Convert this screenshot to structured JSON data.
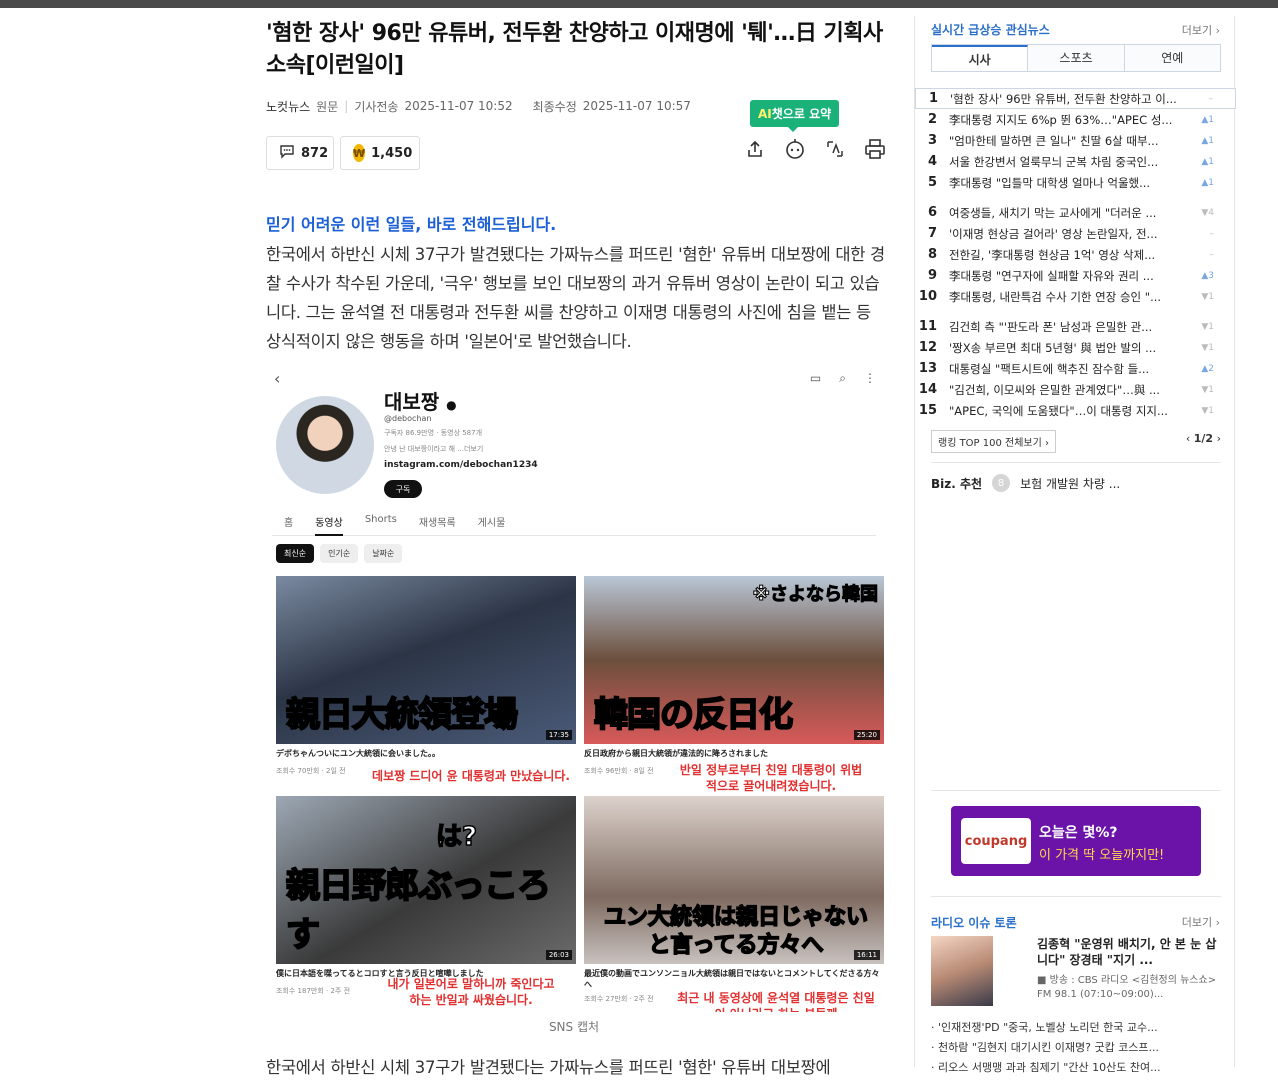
{
  "article": {
    "headline": "'혐한 장사' 96만 유튜버, 전두환 찬양하고 이재명에 '퉤'…日 기획사 소속[이런일이]",
    "source": "노컷뉴스",
    "source_tag": "원문",
    "sent_label": "기사전송",
    "sent_time": "2025-11-07 10:52",
    "edited_label": "최종수정",
    "edited_time": "2025-11-07 10:57",
    "comment_count": "872",
    "reaction_count": "1,450",
    "ai_tooltip_ai": "AI",
    "ai_tooltip_rest": "챗으로 요약",
    "lede": "믿기 어려운 이런 일들, 바로 전해드립니다.",
    "paragraph1": "한국에서 하반신 시체 37구가 발견됐다는 가짜뉴스를 퍼뜨린 '혐한' 유튜버 대보짱에 대한 경찰 수사가 착수된 가운데, '극우' 행보를 보인 대보짱의 과거 유튜버 영상이 논란이 되고 있습니다. 그는 윤석열 전 대통령과 전두환 씨를 찬양하고 이재명 대통령의 사진에 침을 뱉는 등 상식적이지 않은 행동을 하며 '일본어'로 발언했습니다.",
    "image_credit": "SNS 캡처",
    "paragraph2": "한국에서 하반신 시체 37구가 발견됐다는 가짜뉴스를 퍼뜨린 '혐한' 유튜버 대보짱에"
  },
  "screenshot": {
    "channel_name": "대보짱",
    "handle": "@debochan",
    "stats": "구독자 86.9만명 · 동영상 587개",
    "desc": "안녕 난 대보짱이라고 해 ...더보기",
    "link": "instagram.com/debochan1234",
    "subscribe": "구독",
    "tabs": [
      "홈",
      "동영상",
      "Shorts",
      "재생목록",
      "게시물"
    ],
    "chips": [
      "최신순",
      "인기순",
      "날짜순"
    ],
    "videos": [
      {
        "big": "親日大統領登場",
        "dur": "17:35",
        "caption": "デボちゃんついにユン大統領に会いました。。",
        "meta": "조회수 70만회 · 2일 전",
        "kr": "데보짱 드디어 윤 대통령과 만났습니다."
      },
      {
        "big": "韓国の反日化",
        "dur": "25:20",
        "corner": "※さよなら韓国",
        "caption": "反日政府から親日大統領が違法的に降ろされました",
        "meta": "조회수 96만회 · 8일 전",
        "kr": "반일 정부로부터 친일 대통령이 위법적으로 끌어내려졌습니다."
      },
      {
        "big": "親日野郎ぶっころす",
        "dur": "26:03",
        "corner": "は?",
        "caption": "僕に日本語を喋ってるとコロすと言う反日と喧嘩しました",
        "meta": "조회수 187만회 · 2주 전",
        "kr": "내가 일본어로 말하니까 죽인다고 하는 반일과 싸웠습니다."
      },
      {
        "big": "ユン大統領は親日じゃないと言ってる方々へ",
        "dur": "16:11",
        "caption": "最近僕の動画でユンソンニョル大統領は親日ではないとコメントしてくださる方々へ",
        "meta": "조회수 27만회 · 2주 전",
        "kr": "최근 내 동영상에 윤석열 대통령은 친일이 아니라고 하는 분들께"
      }
    ]
  },
  "sidebar": {
    "title": "실시간 급상승 관심뉴스",
    "more": "더보기",
    "tabs": [
      "시사",
      "스포츠",
      "연예"
    ],
    "ranks": [
      {
        "n": "1",
        "t": "'혐한 장사' 96만 유튜버, 전두환 찬양하고 이...",
        "c": "–"
      },
      {
        "n": "2",
        "t": "李대통령 지지도 6%p 뛴 63%…\"APEC 성...",
        "c": "1"
      },
      {
        "n": "3",
        "t": "\"엄마한테 말하면 큰 일나\" 친딸 6살 때부...",
        "c": "1"
      },
      {
        "n": "4",
        "t": "서울 한강변서 얼룩무늬 군복 차림 중국인...",
        "c": "1"
      },
      {
        "n": "5",
        "t": "李대통령 \"입틀막 대학생 얼마나 억울했...",
        "c": "1"
      },
      {
        "n": "6",
        "t": "여중생들, 새치기 막는 교사에게 \"더러운 ...",
        "c": "4"
      },
      {
        "n": "7",
        "t": "'이재명 현상금 걸어라' 영상 논란일자, 전...",
        "c": "–"
      },
      {
        "n": "8",
        "t": "전한길, '李대통령 현상금 1억' 영상 삭제...",
        "c": "–"
      },
      {
        "n": "9",
        "t": "李대통령 \"연구자에 실패할 자유와 권리 ...",
        "c": "3"
      },
      {
        "n": "10",
        "t": "李대통령, 내란특검 수사 기한 연장 승인 \"...",
        "c": "1"
      },
      {
        "n": "11",
        "t": "김건희 측 \"'판도라 폰' 남성과 은밀한 관...",
        "c": "1"
      },
      {
        "n": "12",
        "t": "'짱X송 부르면 최대 5년형' 與 법안 발의 ...",
        "c": "1"
      },
      {
        "n": "13",
        "t": "대통령실 \"팩트시트에 핵추진 잠수함 들...",
        "c": "2"
      },
      {
        "n": "14",
        "t": "\"김건희, 이모씨와 은밀한 관계였다\"…與 ...",
        "c": "1"
      },
      {
        "n": "15",
        "t": "\"APEC, 국익에 도움됐다\"…이 대통령 지지...",
        "c": "1"
      }
    ],
    "rank_all": "랭킹 TOP 100 전체보기",
    "page": "1/2",
    "biz_label": "Biz. 추천",
    "biz_num": "8",
    "biz_text": "보험 개발원 차량 ...",
    "ad_logo": "coupang",
    "ad_line1": "오늘은 몇%?",
    "ad_line2": "이 가격 딱 오늘까지만!",
    "radio_title": "라디오 이슈 토론",
    "radio_more": "더보기",
    "radio_headline": "김종혁 \"운영위 배치기, 안 본 눈 삽니다\" 장경태 \"지기 ...",
    "radio_sub": "방송 : CBS 라디오 <김현정의 뉴스쇼> FM 98.1 (07:10~09:00)...",
    "radio_items": [
      "'인재전쟁'PD \"중국, 노벨상 노리던 한국 교수...",
      "천하람 \"김현지 대기시킨 이재명? 굿캅 코스프...",
      "리오스 서맹맹 과과 침제기 \"간산 10산도 찬여..."
    ]
  }
}
